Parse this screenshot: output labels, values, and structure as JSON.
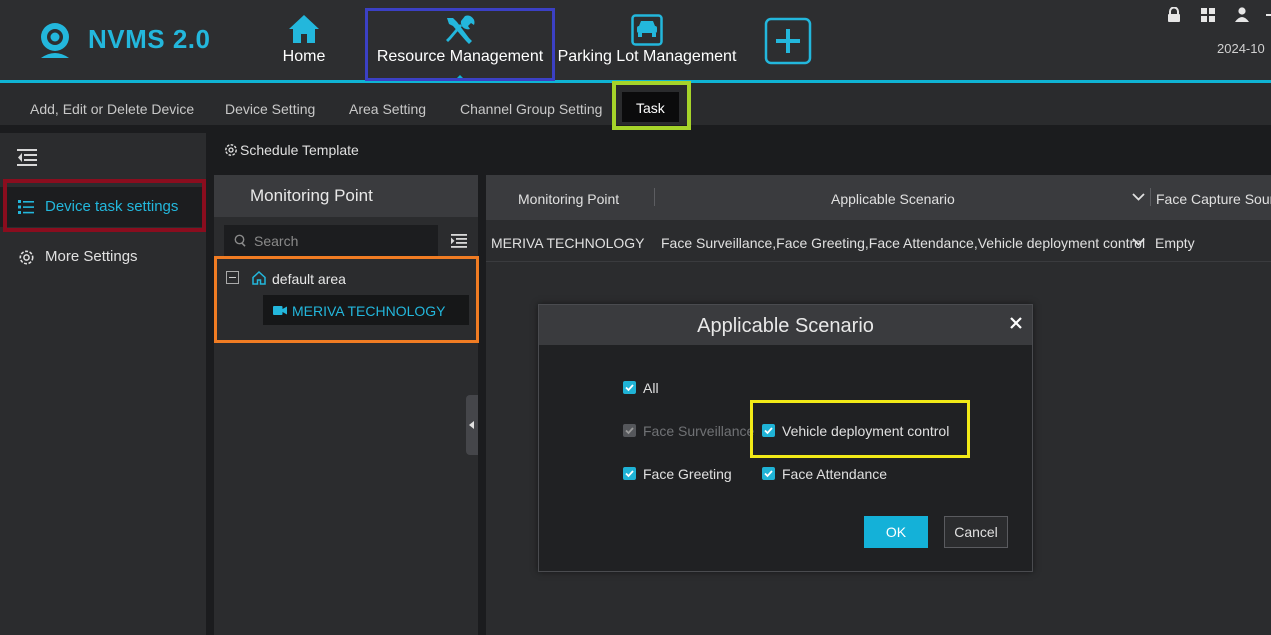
{
  "app": {
    "name": "NVMS 2.0",
    "date": "2024-10"
  },
  "nav": {
    "items": [
      {
        "label": "Home",
        "icon": "home-icon"
      },
      {
        "label": "Resource Management",
        "icon": "tools-icon"
      },
      {
        "label": "Parking Lot Management",
        "icon": "car-icon"
      }
    ],
    "add_icon": "plus-icon",
    "right_icons": [
      "lock-icon",
      "grid-icon",
      "user-icon"
    ]
  },
  "subtabs": [
    "Add, Edit or Delete Device",
    "Device Setting",
    "Area Setting",
    "Channel Group Setting",
    "Task"
  ],
  "sidebar": {
    "items": [
      {
        "label": "Device task settings",
        "icon": "list-icon"
      },
      {
        "label": "More Settings",
        "icon": "gear-icon"
      }
    ]
  },
  "schedule_template": "Schedule Template",
  "monitoring_panel": {
    "title": "Monitoring Point",
    "search_placeholder": "Search",
    "area": "default area",
    "device": "MERIVA TECHNOLOGY"
  },
  "table": {
    "headers": [
      "Monitoring Point",
      "Applicable Scenario",
      "Face Capture Sour"
    ],
    "rows": [
      [
        "MERIVA TECHNOLOGY",
        "Face Surveillance,Face Greeting,Face Attendance,Vehicle deployment control",
        "Empty"
      ]
    ]
  },
  "dialog": {
    "title": "Applicable Scenario",
    "options": [
      {
        "label": "All",
        "checked": true,
        "disabled": false
      },
      {
        "label": "Face Surveillance",
        "checked": true,
        "disabled": true
      },
      {
        "label": "Vehicle deployment control",
        "checked": true,
        "disabled": false
      },
      {
        "label": "Face Greeting",
        "checked": true,
        "disabled": false
      },
      {
        "label": "Face Attendance",
        "checked": true,
        "disabled": false
      }
    ],
    "ok": "OK",
    "cancel": "Cancel"
  },
  "colors": {
    "accent": "#0fb4d4",
    "highlight_blue": "#3b40c4",
    "highlight_green": "#a6d42a",
    "highlight_red": "#8a0d1e",
    "highlight_orange": "#f07c23",
    "highlight_yellow": "#f2ea17"
  }
}
